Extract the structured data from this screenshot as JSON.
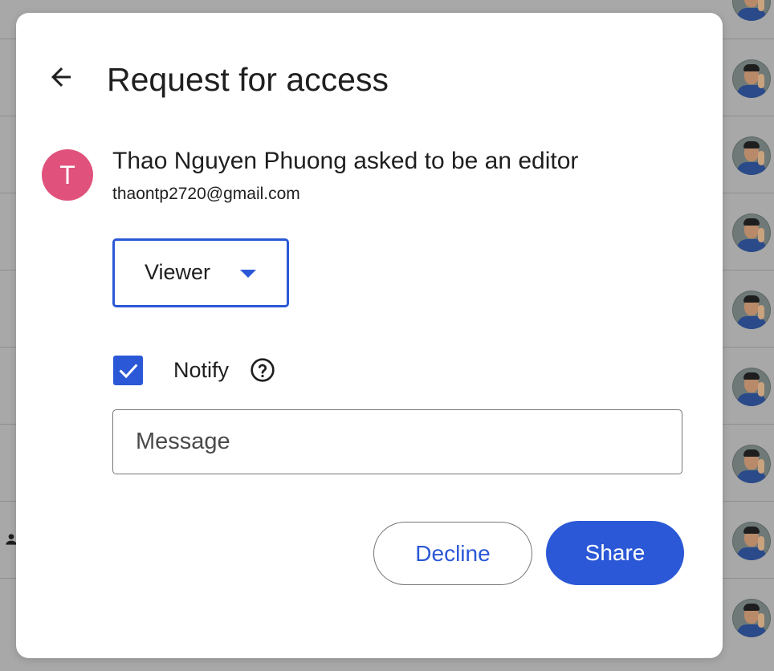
{
  "dialog": {
    "title": "Request for access",
    "back_icon": "arrow-back-icon"
  },
  "request": {
    "avatar_initial": "T",
    "avatar_color": "#e0527c",
    "message": "Thao Nguyen Phuong asked to be an editor",
    "email": "thaontp2720@gmail.com"
  },
  "role": {
    "selected": "Viewer",
    "icon": "caret-down-icon"
  },
  "notify": {
    "label": "Notify",
    "checked": true,
    "help_icon": "help-circle-icon"
  },
  "message_field": {
    "placeholder": "Message",
    "value": ""
  },
  "actions": {
    "decline_label": "Decline",
    "share_label": "Share"
  },
  "colors": {
    "accent": "#2b58d6",
    "backdrop": "#a8a8a8"
  }
}
